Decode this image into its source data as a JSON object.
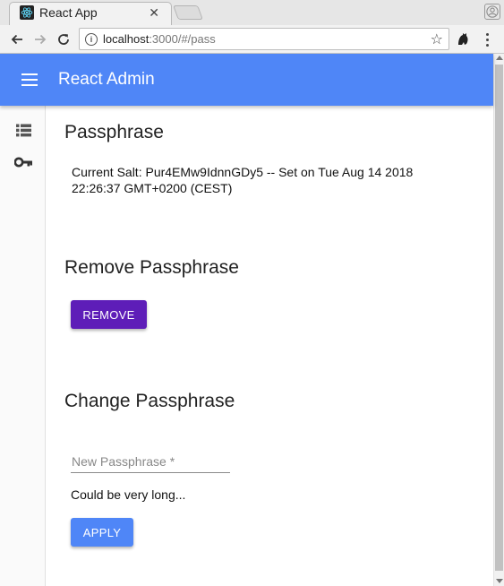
{
  "browser": {
    "tab_title": "React App",
    "tab_close": "✕",
    "url_host": "localhost",
    "url_path": ":3000/#/pass",
    "star": "☆"
  },
  "app": {
    "title": "React Admin",
    "brand_color": "#4f86f7"
  },
  "sidebar": {
    "items": [
      {
        "icon": "list-icon"
      },
      {
        "icon": "key-icon"
      }
    ]
  },
  "passphrase": {
    "heading": "Passphrase",
    "salt_text": "Current Salt: Pur4EMw9IdnnGDy5 -- Set on Tue Aug 14 2018 22:26:37 GMT+0200 (CEST)"
  },
  "remove": {
    "heading": "Remove Passphrase",
    "button_label": "REMOVE",
    "button_color": "#5e1db8"
  },
  "change": {
    "heading": "Change Passphrase",
    "input_placeholder": "New Passphrase *",
    "input_value": "",
    "hint": "Could be very long...",
    "button_label": "APPLY"
  }
}
